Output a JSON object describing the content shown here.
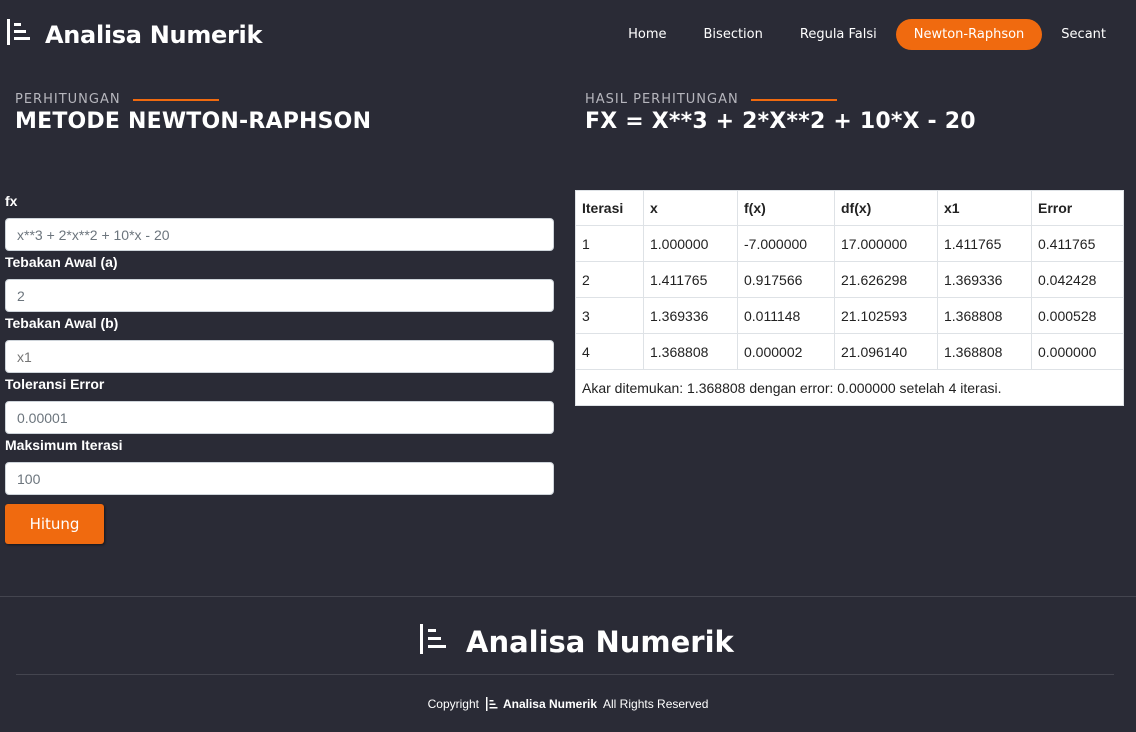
{
  "brand": {
    "name": "Analisa Numerik",
    "icon": "bars-logo-icon"
  },
  "nav": {
    "items": [
      {
        "label": "Home",
        "active": false
      },
      {
        "label": "Bisection",
        "active": false
      },
      {
        "label": "Regula Falsi",
        "active": false
      },
      {
        "label": "Newton-Raphson",
        "active": true
      },
      {
        "label": "Secant",
        "active": false
      }
    ]
  },
  "left_section": {
    "subtitle": "PERHITUNGAN",
    "title": "METODE NEWTON-RAPHSON"
  },
  "right_section": {
    "subtitle": "HASIL PERHITUNGAN",
    "title": "FX = X**3 + 2*X**2 + 10*X - 20"
  },
  "form": {
    "fx": {
      "label": "fx",
      "value": "x**3 + 2*x**2 + 10*x - 20"
    },
    "a": {
      "label": "Tebakan Awal (a)",
      "value": "2"
    },
    "b": {
      "label": "Tebakan Awal (b)",
      "placeholder": "x1"
    },
    "tol": {
      "label": "Toleransi Error",
      "value": "0.00001"
    },
    "maxit": {
      "label": "Maksimum Iterasi",
      "value": "100"
    },
    "submit_label": "Hitung"
  },
  "table": {
    "headers": [
      "Iterasi",
      "x",
      "f(x)",
      "df(x)",
      "x1",
      "Error"
    ],
    "rows": [
      [
        "1",
        "1.000000",
        "-7.000000",
        "17.000000",
        "1.411765",
        "0.411765"
      ],
      [
        "2",
        "1.411765",
        "0.917566",
        "21.626298",
        "1.369336",
        "0.042428"
      ],
      [
        "3",
        "1.369336",
        "0.011148",
        "21.102593",
        "1.368808",
        "0.000528"
      ],
      [
        "4",
        "1.368808",
        "0.000002",
        "21.096140",
        "1.368808",
        "0.000000"
      ]
    ],
    "result_text": "Akar ditemukan: 1.368808 dengan error: 0.000000 setelah 4 iterasi."
  },
  "footer": {
    "brand": "Analisa Numerik",
    "copyright_prefix": "Copyright",
    "copyright_brand": "Analisa Numerik",
    "copyright_suffix": "All Rights Reserved"
  },
  "colors": {
    "accent": "#f06a0f",
    "background": "#2a2b36"
  }
}
